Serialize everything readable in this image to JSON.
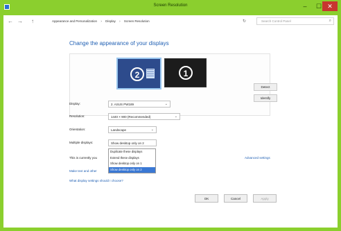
{
  "window": {
    "title": "Screen Resolution",
    "controls": {
      "minimize": "–",
      "maximize": "☐",
      "close": "✕"
    }
  },
  "address_bar": {
    "back": "←",
    "forward": "→",
    "up": "↑",
    "breadcrumbs": [
      "Appearance and Personalization",
      "›",
      "Display",
      "›",
      "Screen Resolution"
    ],
    "refresh": "↻",
    "search_placeholder": "Search Control Panel"
  },
  "heading": "Change the appearance of your displays",
  "preview": {
    "monitors": [
      {
        "number": "2",
        "selected": true
      },
      {
        "number": "1",
        "selected": false
      }
    ],
    "detect_label": "Detect",
    "identify_label": "Identify"
  },
  "fields": {
    "display": {
      "label": "Display:",
      "value": "2. ASUS PW189"
    },
    "resolution": {
      "label": "Resolution:",
      "value": "1440 × 900 (Recommended)"
    },
    "orientation": {
      "label": "Orientation:",
      "value": "Landscape"
    },
    "multiple_displays": {
      "label": "Multiple displays:",
      "value": "Show desktop only on 2",
      "options": [
        "Duplicate these displays",
        "Extend these displays",
        "Show desktop only on 1",
        "Show desktop only on 2"
      ],
      "selected_index": 3
    }
  },
  "current_text": "This is currently you",
  "advanced_link": "Advanced settings",
  "make_text_link": "Make text and other",
  "settings_link": "What display settings should I choose?",
  "buttons": {
    "ok": "OK",
    "cancel": "Cancel",
    "apply": "Apply"
  },
  "colors": {
    "accent": "#8bcf2e",
    "link": "#1f5fb3",
    "selection": "#3a78d4"
  }
}
